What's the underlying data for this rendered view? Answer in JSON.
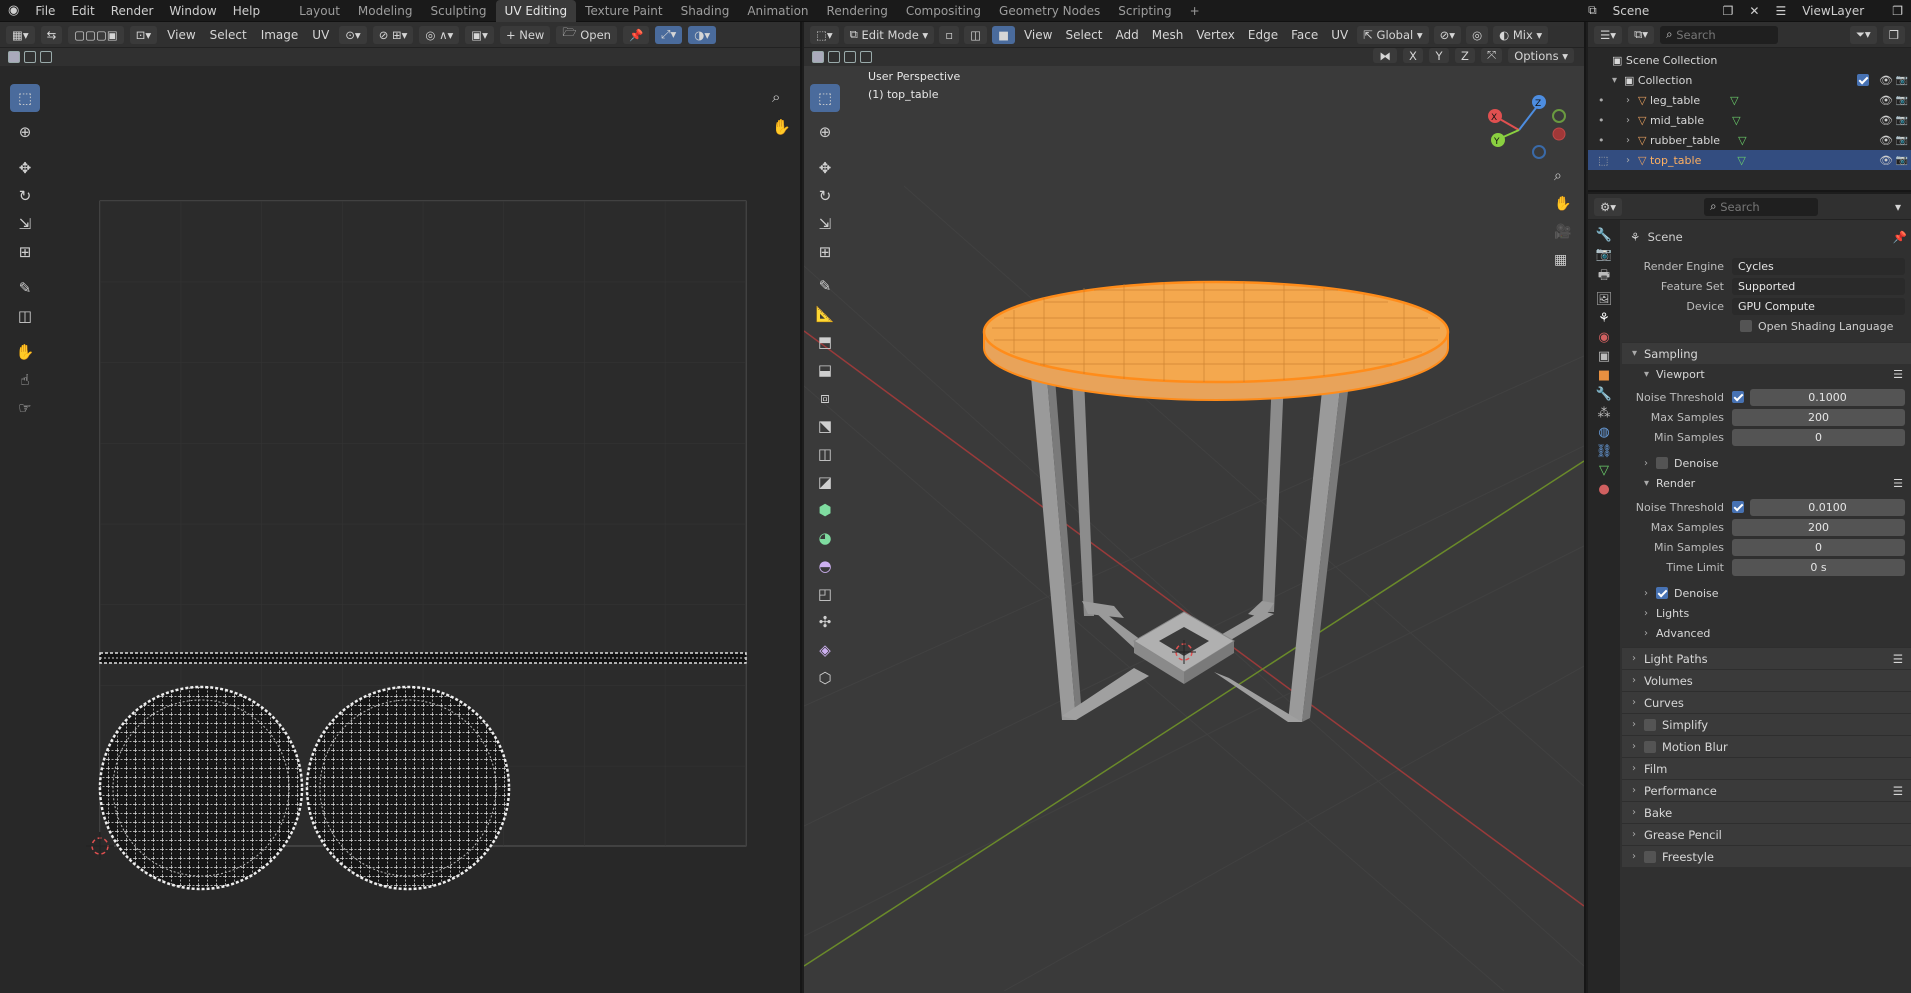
{
  "top_menu": [
    "File",
    "Edit",
    "Render",
    "Window",
    "Help"
  ],
  "workspaces": [
    "Layout",
    "Modeling",
    "Sculpting",
    "UV Editing",
    "Texture Paint",
    "Shading",
    "Animation",
    "Rendering",
    "Compositing",
    "Geometry Nodes",
    "Scripting"
  ],
  "active_workspace": "UV Editing",
  "scene_name": "Scene",
  "view_layer": "ViewLayer",
  "uv_editor": {
    "menus": [
      "View",
      "Select",
      "Image",
      "UV"
    ],
    "new_label": "New",
    "open_label": "Open"
  },
  "viewport": {
    "mode": "Edit Mode",
    "menus": [
      "View",
      "Select",
      "Add",
      "Mesh",
      "Vertex",
      "Edge",
      "Face",
      "UV"
    ],
    "transform_orientation": "Global",
    "shading_label": "Mix",
    "options_label": "Options",
    "axis_x": "X",
    "axis_y": "Y",
    "axis_z": "Z",
    "overlay_title": "User Perspective",
    "overlay_object": "(1) top_table",
    "gizmo": {
      "x": "X",
      "y": "Y",
      "z": "Z"
    }
  },
  "outliner": {
    "search_placeholder": "Search",
    "scene_collection": "Scene Collection",
    "collection": "Collection",
    "objects": [
      {
        "name": "leg_table",
        "selected": false
      },
      {
        "name": "mid_table",
        "selected": false
      },
      {
        "name": "rubber_table",
        "selected": false
      },
      {
        "name": "top_table",
        "selected": true
      }
    ]
  },
  "properties": {
    "search_placeholder": "Search",
    "context": "Scene",
    "render_engine_label": "Render Engine",
    "render_engine": "Cycles",
    "feature_set_label": "Feature Set",
    "feature_set": "Supported",
    "device_label": "Device",
    "device": "GPU Compute",
    "osl_label": "Open Shading Language",
    "sampling": "Sampling",
    "viewport": "Viewport",
    "noise_threshold_label": "Noise Threshold",
    "viewport_noise": "0.1000",
    "max_samples_label": "Max Samples",
    "viewport_max": "200",
    "min_samples_label": "Min Samples",
    "viewport_min": "0",
    "denoise_label": "Denoise",
    "render": "Render",
    "render_noise": "0.0100",
    "render_max": "200",
    "render_min": "0",
    "time_limit_label": "Time Limit",
    "time_limit": "0 s",
    "lights": "Lights",
    "advanced": "Advanced",
    "sections": [
      "Light Paths",
      "Volumes",
      "Curves",
      "Simplify",
      "Motion Blur",
      "Film",
      "Performance",
      "Bake",
      "Grease Pencil",
      "Freestyle"
    ]
  },
  "colors": {
    "accent": "#4772b3",
    "selection": "#ff9a2e",
    "ui_bg": "#303030"
  }
}
